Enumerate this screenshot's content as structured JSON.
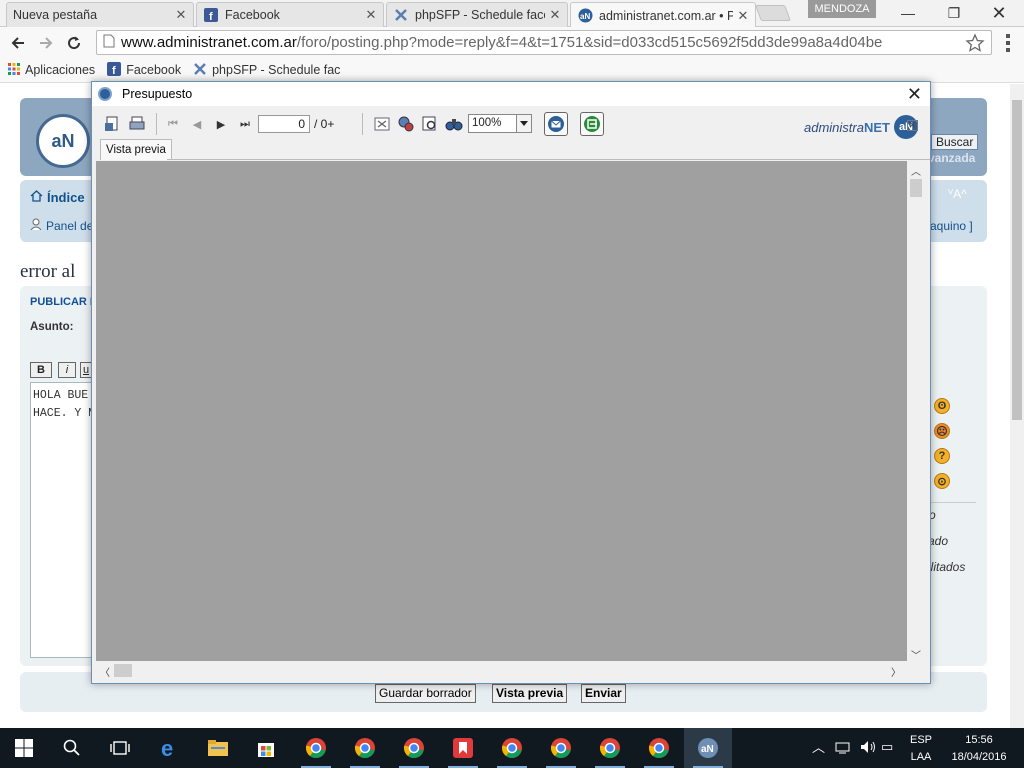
{
  "browser": {
    "tabs": [
      {
        "title": "Nueva pestaña",
        "active": false
      },
      {
        "title": "Facebook",
        "active": false
      },
      {
        "title": "phpSFP - Schedule faceb",
        "active": false
      },
      {
        "title": "administranet.com.ar • Pi",
        "active": true
      }
    ],
    "profile": "MENDOZA",
    "url_host": "www.administranet.com.ar",
    "url_path": "/foro/posting.php?mode=reply&f=4&t=1751&sid=d033cd515c5692f5dd3de99a8a4d04be",
    "bookmarks": [
      "Aplicaciones",
      "Facebook",
      "phpSFP - Schedule fac"
    ]
  },
  "page": {
    "search_button": "Buscar",
    "advanced_search": "vanzada",
    "index_link": "Índice",
    "panel_link": "Panel de",
    "login_link": "aquino ]",
    "font_size": "ⱽA^",
    "error_title": "error al",
    "publicar": "PUBLICAR I",
    "asunto": "Asunto:",
    "fmt_bold": "B",
    "fmt_italic": "i",
    "fmt_underline": "u",
    "editor_line1": "HOLA BUE",
    "editor_line2": "HACE. Y M",
    "options": [
      "o",
      "ado",
      "ilitados"
    ],
    "buttons": {
      "save_draft": "Guardar borrador",
      "preview": "Vista previa",
      "send": "Enviar"
    }
  },
  "modal": {
    "title": "Presupuesto",
    "page_input": "0",
    "page_total": "/ 0+",
    "zoom": "100%",
    "brand_name": "administra",
    "brand_net": "NET",
    "tab_label": "Vista previa"
  },
  "taskbar": {
    "lang": "ESP",
    "layout": "LAA",
    "time": "15:56",
    "date": "18/04/2016"
  },
  "colors": {
    "header_blue": "#8ea7c0",
    "nav_panel": "#cfdeeb",
    "preview_grey": "#a0a0a0",
    "taskbar": "#101820"
  }
}
